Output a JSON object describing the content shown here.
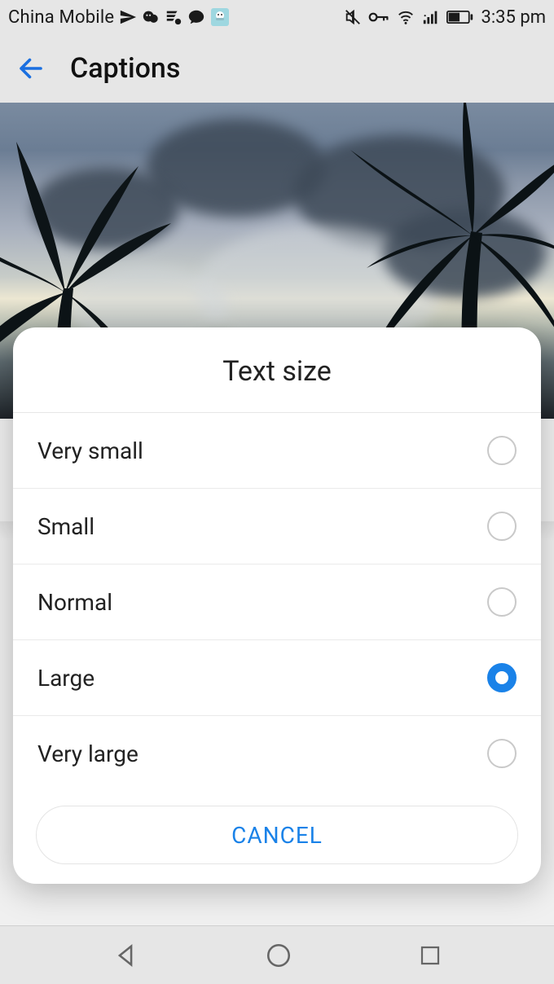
{
  "status": {
    "carrier": "China Mobile",
    "time": "3:35 pm"
  },
  "header": {
    "title": "Captions"
  },
  "dialog": {
    "title": "Text size",
    "options": [
      {
        "label": "Very small",
        "selected": false
      },
      {
        "label": "Small",
        "selected": false
      },
      {
        "label": "Normal",
        "selected": false
      },
      {
        "label": "Large",
        "selected": true
      },
      {
        "label": "Very large",
        "selected": false
      }
    ],
    "cancel_label": "CANCEL"
  },
  "colors": {
    "accent": "#1a82e8"
  }
}
